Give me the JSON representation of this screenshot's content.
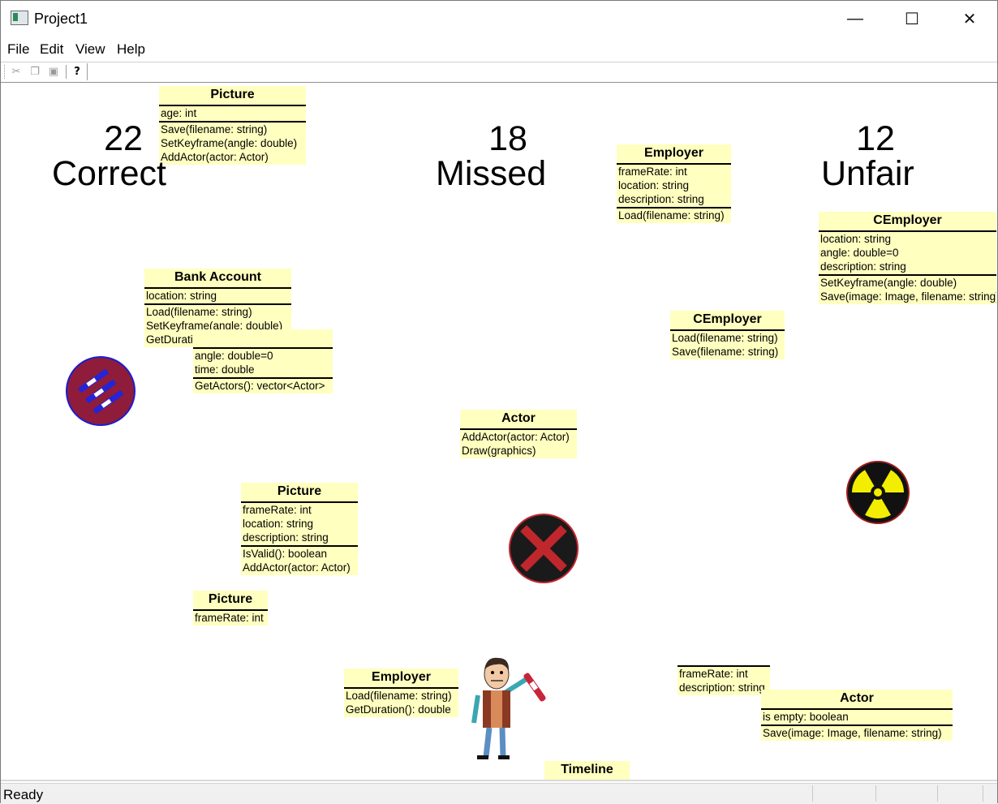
{
  "window": {
    "title": "Project1",
    "controls": {
      "minimize": "—",
      "maximize": "☐",
      "close": "✕"
    }
  },
  "menu": [
    "File",
    "Edit",
    "View",
    "Help"
  ],
  "toolbar": {
    "cut_icon": "scissors-icon",
    "copy_icon": "copy-icon",
    "paste_icon": "paste-icon",
    "help_icon": "help-icon",
    "cut_glyph": "✂",
    "copy_glyph": "❐",
    "paste_glyph": "▣",
    "help_glyph": "?"
  },
  "scores": {
    "correct": {
      "value": "22",
      "label": "Correct"
    },
    "missed": {
      "value": "18",
      "label": "Missed"
    },
    "unfair": {
      "value": "12",
      "label": "Unfair"
    }
  },
  "classes": {
    "picture_top": {
      "name": "Picture",
      "attrs": [
        "age: int"
      ],
      "ops": [
        "Save(filename: string)",
        "SetKeyframe(angle: double)",
        "AddActor(actor: Actor)"
      ]
    },
    "employer_top": {
      "name": "Employer",
      "attrs": [
        "frameRate: int",
        "location: string",
        "description: string"
      ],
      "ops": [
        "Load(filename: string)"
      ]
    },
    "cemployer_right": {
      "name": "CEmployer",
      "attrs": [
        "location: string",
        "angle: double=0",
        "description: string"
      ],
      "ops": [
        "SetKeyframe(angle: double)",
        "Save(image: Image, filename: string)"
      ]
    },
    "bank_account": {
      "name": "Bank  Account",
      "attrs": [
        "location: string"
      ],
      "ops": [
        "Load(filename: string)",
        "SetKeyframe(angle: double)",
        "GetDuration(): double"
      ]
    },
    "unnamed_mid": {
      "attrs": [
        "angle: double=0",
        "time: double"
      ],
      "ops": [
        "GetActors(): vector<Actor>"
      ]
    },
    "cemployer_mid": {
      "name": "CEmployer",
      "ops": [
        "Load(filename: string)",
        "Save(filename: string)"
      ]
    },
    "actor_mid": {
      "name": "Actor",
      "ops": [
        "AddActor(actor: Actor)",
        "Draw(graphics)"
      ]
    },
    "picture_mid": {
      "name": "Picture",
      "attrs": [
        "frameRate: int",
        "location: string",
        "description: string"
      ],
      "ops": [
        "IsValid(): boolean",
        "AddActor(actor: Actor)"
      ]
    },
    "picture_small": {
      "name": "Picture",
      "attrs": [
        "frameRate: int"
      ]
    },
    "employer_bottom": {
      "name": "Employer",
      "ops": [
        "Load(filename: string)",
        "GetDuration(): double"
      ]
    },
    "unnamed_bottom": {
      "attrs": [
        "frameRate: int",
        "description: string"
      ]
    },
    "actor_bottom": {
      "name": "Actor",
      "attrs": [
        "is  empty: boolean"
      ],
      "ops": [
        "Save(image: Image, filename: string)"
      ]
    },
    "timeline": {
      "name": "Timeline"
    }
  },
  "icons": {
    "pens_badge": "pens-badge-icon",
    "x_badge": "x-mark-icon",
    "radiation_badge": "radiation-icon",
    "character": "character-with-pen-icon"
  },
  "colors": {
    "uml_fill": "#ffffc0",
    "pens_badge": "#8e1c3a",
    "x_badge": "#1a1a1a",
    "x_mark": "#c0272d",
    "radiation": "#f3ee00"
  },
  "status": {
    "text": "Ready"
  }
}
